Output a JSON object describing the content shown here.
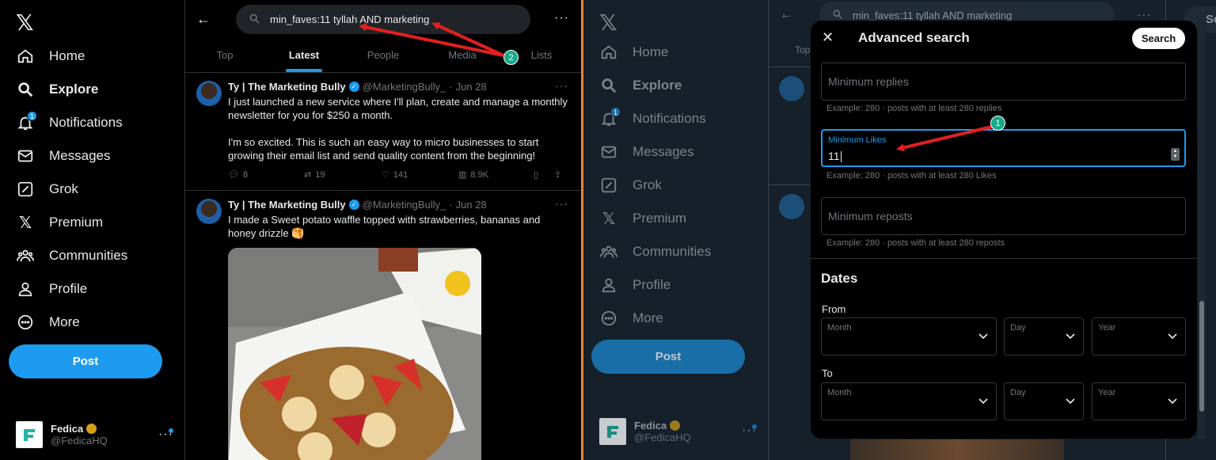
{
  "colors": {
    "accent": "#1d9bf0",
    "annotation_arrow": "#e02020",
    "step_badge": "#1aa88a",
    "divider": "#e8833a"
  },
  "left": {
    "nav": [
      {
        "label": "Home",
        "icon": "home-icon"
      },
      {
        "label": "Explore",
        "icon": "search-icon",
        "active": true
      },
      {
        "label": "Notifications",
        "icon": "bell-icon",
        "badge": "1"
      },
      {
        "label": "Messages",
        "icon": "envelope-icon"
      },
      {
        "label": "Grok",
        "icon": "grok-icon"
      },
      {
        "label": "Premium",
        "icon": "x-logo-icon"
      },
      {
        "label": "Communities",
        "icon": "communities-icon"
      },
      {
        "label": "Profile",
        "icon": "person-icon"
      },
      {
        "label": "More",
        "icon": "more-circle-icon"
      }
    ],
    "post_label": "Post",
    "account": {
      "name": "Fedica",
      "handle": "@FedicaHQ"
    },
    "search_query": "min_faves:11 tyllah AND marketing",
    "tabs": [
      "Top",
      "Latest",
      "People",
      "Media",
      "Lists"
    ],
    "active_tab": "Latest",
    "tweets": [
      {
        "name": "Ty | The Marketing Bully",
        "handle": "@MarketingBully_",
        "date": "Jun 28",
        "text1": "I just launched a new service where I'll plan, create and manage a monthly newsletter for you for $250 a month.",
        "text2": "I'm so excited. This is such an easy way to micro businesses to start growing their email list and send quality content from the beginning!",
        "replies": "8",
        "reposts": "19",
        "likes": "141",
        "views": "8.9K"
      },
      {
        "name": "Ty | The Marketing Bully",
        "handle": "@MarketingBully_",
        "date": "Jun 28",
        "text1": "I made a Sweet potato waffle topped with strawberries, bananas and honey drizzle 🥞"
      }
    ],
    "step_badge": "2"
  },
  "right": {
    "nav": [
      {
        "label": "Home",
        "icon": "home-icon"
      },
      {
        "label": "Explore",
        "icon": "search-icon"
      },
      {
        "label": "Notifications",
        "icon": "bell-icon",
        "badge": "1"
      },
      {
        "label": "Messages",
        "icon": "envelope-icon"
      },
      {
        "label": "Grok",
        "icon": "grok-icon"
      },
      {
        "label": "Premium",
        "icon": "x-logo-icon"
      },
      {
        "label": "Communities",
        "icon": "communities-icon"
      },
      {
        "label": "Profile",
        "icon": "person-icon"
      },
      {
        "label": "More",
        "icon": "more-circle-icon"
      }
    ],
    "post_label": "Post",
    "account": {
      "name": "Fedica",
      "handle": "@FedicaHQ"
    },
    "search_query": "min_faves:11 tyllah AND marketing",
    "bg_tab": "Top",
    "right_col_search": "Sea",
    "modal": {
      "title": "Advanced search",
      "search_button": "Search",
      "min_replies_placeholder": "Minimum replies",
      "min_replies_hint": "Example: 280 · posts with at least 280 replies",
      "min_likes_label": "Minimum Likes",
      "min_likes_value": "11",
      "min_likes_hint": "Example: 280 · posts with at least 280 Likes",
      "min_reposts_placeholder": "Minimum reposts",
      "min_reposts_hint": "Example: 280 · posts with at least 280 reposts",
      "dates_title": "Dates",
      "from_label": "From",
      "to_label": "To",
      "month_label": "Month",
      "day_label": "Day",
      "year_label": "Year"
    },
    "step_badge": "1"
  }
}
